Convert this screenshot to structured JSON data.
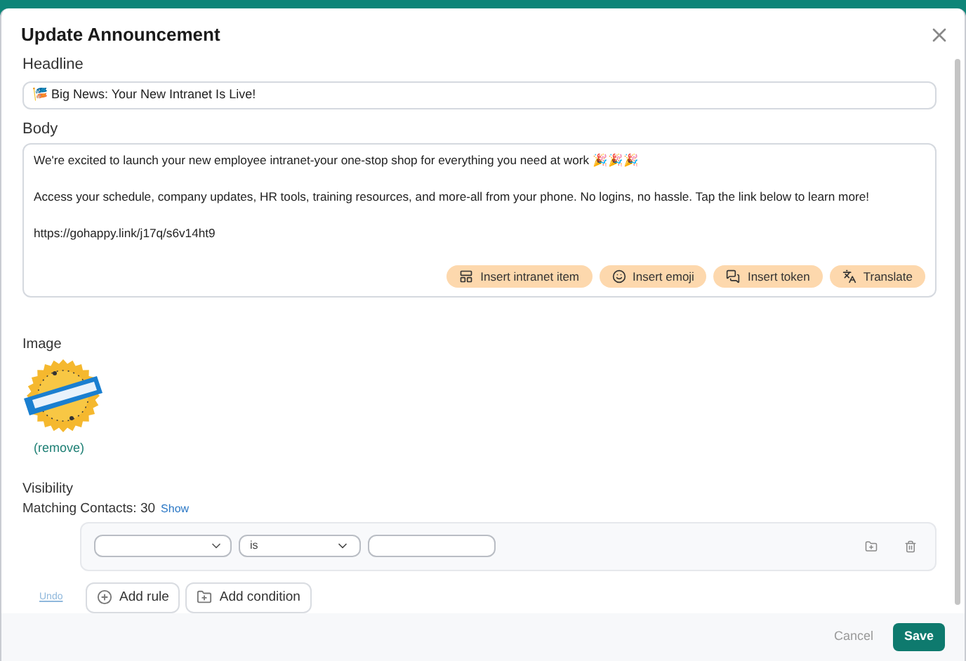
{
  "dialog": {
    "title": "Update Announcement"
  },
  "headline": {
    "label": "Headline",
    "value": "🎏 Big News: Your New Intranet Is Live!"
  },
  "body": {
    "label": "Body",
    "paragraphs": [
      "We're excited to launch your new employee intranet-your one-stop shop for everything you need at work 🎉🎉🎉",
      "Access your schedule, company updates, HR tools, training resources, and more-all from your phone. No logins, no hassle. Tap the link below to learn more!",
      "https://gohappy.link/j17q/s6v14ht9"
    ],
    "actions": [
      {
        "kind": "intranet",
        "label": "Insert intranet item"
      },
      {
        "kind": "emoji",
        "label": "Insert emoji"
      },
      {
        "kind": "token",
        "label": "Insert token"
      },
      {
        "kind": "translate",
        "label": "Translate"
      }
    ]
  },
  "image": {
    "label": "Image",
    "remove": "(remove)"
  },
  "visibility": {
    "label": "Visibility",
    "matching": "Matching Contacts: 30",
    "show": "Show",
    "rule": {
      "operator": "is"
    },
    "undo": "Undo",
    "add_rule": "Add rule",
    "add_condition": "Add condition"
  },
  "footer": {
    "cancel": "Cancel",
    "save": "Save"
  }
}
